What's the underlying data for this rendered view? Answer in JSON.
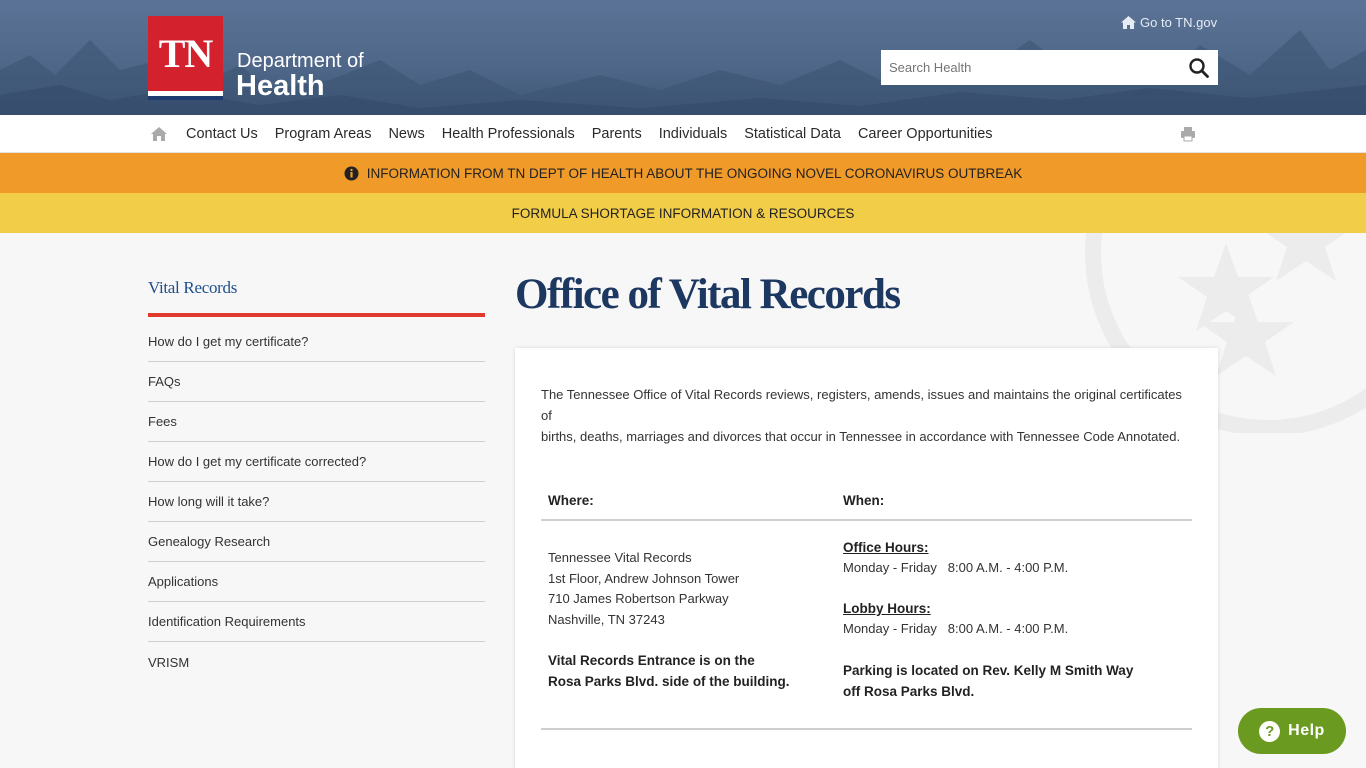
{
  "header": {
    "logo_text": "TN",
    "dept_line1": "Department of",
    "dept_line2": "Health",
    "go_tn_label": "Go to TN.gov",
    "search_placeholder": "Search Health"
  },
  "nav": {
    "items": [
      "Contact Us",
      "Program Areas",
      "News",
      "Health Professionals",
      "Parents",
      "Individuals",
      "Statistical Data",
      "Career Opportunities"
    ]
  },
  "alerts": {
    "covid": "INFORMATION FROM TN DEPT OF HEALTH ABOUT THE ONGOING NOVEL CORONAVIRUS OUTBREAK",
    "formula": "FORMULA SHORTAGE INFORMATION & RESOURCES"
  },
  "sidebar": {
    "title": "Vital Records",
    "items": [
      "How do I get my certificate?",
      "FAQs",
      "Fees",
      "How do I get my certificate corrected?",
      "How long will it take?",
      "Genealogy Research",
      "Applications",
      "Identification Requirements",
      "VRISM"
    ]
  },
  "main": {
    "title": "Office of Vital Records",
    "intro_line1": "The Tennessee Office of Vital Records reviews, registers, amends, issues and maintains the original certificates of",
    "intro_line2": "births, deaths, marriages and divorces that occur in Tennessee in accordance with Tennessee Code Annotated.",
    "where_heading": "Where:",
    "when_heading": "When:",
    "address": [
      "Tennessee Vital Records",
      "1st Floor, Andrew Johnson Tower",
      "710 James Robertson Parkway",
      "Nashville, TN  37243"
    ],
    "entrance_line1": "Vital Records Entrance is on the",
    "entrance_line2": "Rosa Parks Blvd. side of the building.",
    "office_hours_label": "Office Hours:",
    "office_hours": "Monday - Friday   8:00 A.M. - 4:00 P.M.",
    "lobby_hours_label": "Lobby Hours:",
    "lobby_hours": "Monday - Friday   8:00 A.M. - 4:00 P.M.",
    "parking_line1": "Parking is located on Rev. Kelly M Smith Way",
    "parking_line2": "off Rosa Parks Blvd."
  },
  "help": {
    "label": "Help"
  },
  "colors": {
    "header_blue": "#4e6687",
    "logo_red": "#d3212d",
    "alert_orange": "#ef9a29",
    "alert_yellow": "#f2cd48",
    "sidebar_rule_red": "#e03a2f",
    "title_navy": "#1c3760",
    "help_green": "#6b9a20"
  }
}
